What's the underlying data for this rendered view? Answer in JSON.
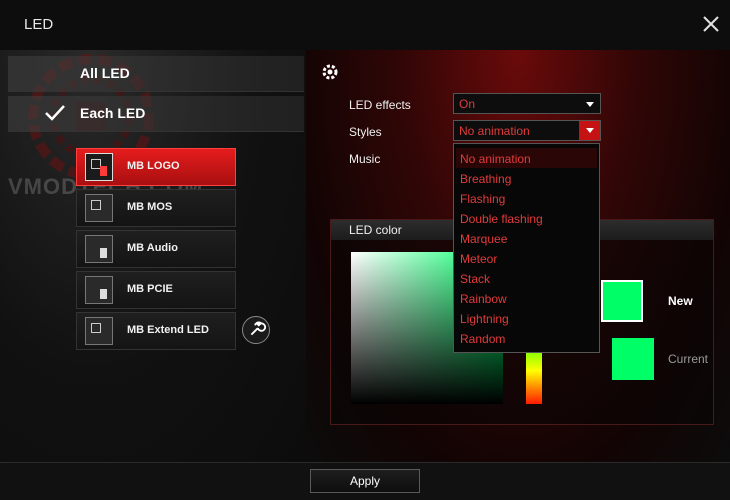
{
  "window": {
    "title": "LED"
  },
  "watermark": {
    "text": "VMODTECH.COM"
  },
  "modes": {
    "all_led": "All LED",
    "each_led": "Each LED",
    "selected": "each_led"
  },
  "devices": [
    {
      "name": "MB LOGO",
      "selected": true
    },
    {
      "name": "MB MOS",
      "selected": false
    },
    {
      "name": "MB Audio",
      "selected": false
    },
    {
      "name": "MB PCIE",
      "selected": false
    },
    {
      "name": "MB Extend LED",
      "selected": false
    }
  ],
  "settings": {
    "led_effects_label": "LED effects",
    "led_effects_value": "On",
    "styles_label": "Styles",
    "styles_value": "No animation",
    "music_label": "Music"
  },
  "style_options": [
    "No animation",
    "Breathing",
    "Flashing",
    "Double flashing",
    "Marquee",
    "Meteor",
    "Stack",
    "Rainbow",
    "Lightning",
    "Random"
  ],
  "led_color": {
    "header": "LED color",
    "new_label": "New",
    "current_label": "Current",
    "new_color": "#00ff66",
    "current_color": "#00ff66"
  },
  "footer": {
    "apply_label": "Apply"
  },
  "colors": {
    "accent": "#c51313",
    "option_text": "#e23b3b"
  }
}
